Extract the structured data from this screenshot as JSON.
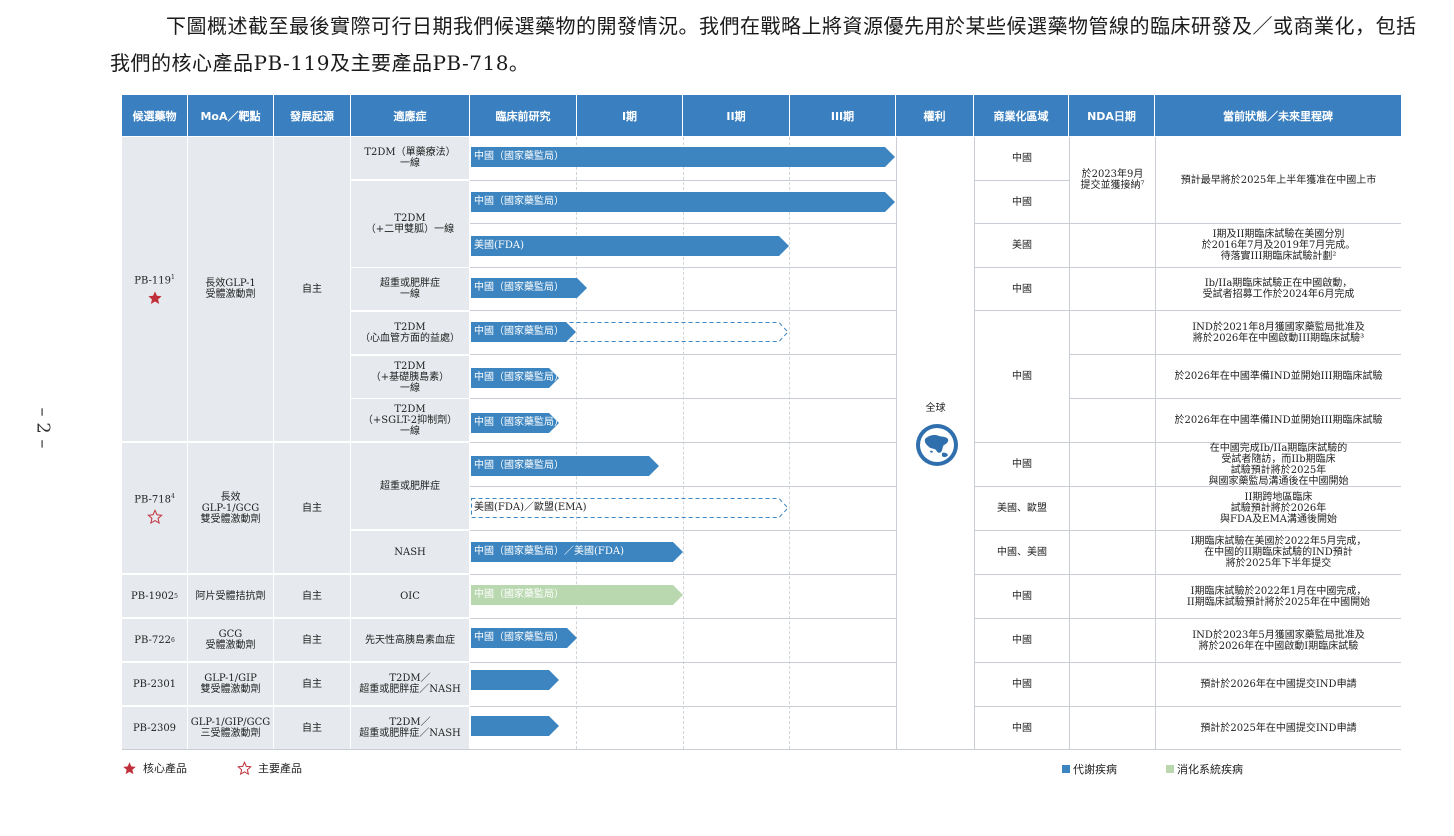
{
  "intro": "下圖概述截至最後實際可行日期我們候選藥物的開發情況。我們在戰略上將資源優先用於某些候選藥物管線的臨床研發及／或商業化，包括我們的核心產品PB-119及主要產品PB-718。",
  "page_number": "– 2 –",
  "headers": [
    "候選藥物",
    "MoA／靶點",
    "發展起源",
    "適應症",
    "臨床前研究",
    "I期",
    "II期",
    "III期",
    "權利",
    "商業化區域",
    "NDA日期",
    "當前狀態／未來里程碑"
  ],
  "drugs": [
    {
      "name": "PB-119",
      "sup": "1",
      "moa": "長效GLP-1\n受體激動劑",
      "origin": "自主"
    },
    {
      "name": "PB-718",
      "sup": "4",
      "moa": "長效\nGLP-1/GCG\n雙受體激動劑",
      "origin": "自主"
    },
    {
      "name": "PB-1902",
      "sup": "5",
      "moa": "阿片受體拮抗劑",
      "origin": "自主"
    },
    {
      "name": "PB-722",
      "sup": "6",
      "moa": "GCG\n受體激動劑",
      "origin": "自主"
    },
    {
      "name": "PB-2301",
      "sup": "",
      "moa": "GLP-1/GIP\n雙受體激動劑",
      "origin": "自主"
    },
    {
      "name": "PB-2309",
      "sup": "",
      "moa": "GLP-1/GIP/GCG\n三受體激動劑",
      "origin": "自主"
    }
  ],
  "indications": [
    "T2DM（單藥療法）\n一線",
    "T2DM\n（+二甲雙胍）一線",
    "超重或肥胖症\n一線",
    "T2DM\n（心血管方面的益處）",
    "T2DM\n（+基礎胰島素）\n一線",
    "T2DM\n（+SGLT-2抑制劑）\n一線",
    "超重或肥胖症",
    "NASH",
    "OIC",
    "先天性高胰島素血症",
    "T2DM／\n超重或肥胖症／NASH",
    "T2DM／\n超重或肥胖症／NASH"
  ],
  "bars": [
    {
      "label": "中國（國家藥監局）",
      "progress": "III期",
      "type": "solid"
    },
    {
      "label": "中國（國家藥監局）",
      "progress": "III期",
      "type": "solid"
    },
    {
      "label": "美國(FDA)",
      "progress": "II期",
      "type": "solid"
    },
    {
      "label": "中國（國家藥監局）",
      "progress": "I期",
      "type": "solid"
    },
    {
      "label": "中國（國家藥監局）",
      "progress": "臨床前研究",
      "type": "solid",
      "planned_to": "II期"
    },
    {
      "label": "中國（國家藥監局）",
      "progress": "臨床前研究",
      "type": "solid"
    },
    {
      "label": "中國（國家藥監局）",
      "progress": "臨床前研究",
      "type": "solid"
    },
    {
      "label": "中國（國家藥監局）",
      "progress": "I期",
      "type": "solid"
    },
    {
      "label": "美國(FDA)／歐盟(EMA)",
      "progress": "II期",
      "type": "planned"
    },
    {
      "label": "中國（國家藥監局）／美國(FDA)",
      "progress": "I期",
      "type": "solid"
    },
    {
      "label": "中國（國家藥監局）",
      "progress": "I期",
      "type": "green"
    },
    {
      "label": "中國（國家藥監局）",
      "progress": "臨床前研究",
      "type": "solid"
    },
    {
      "label": "",
      "progress": "臨床前研究",
      "type": "solid"
    },
    {
      "label": "",
      "progress": "臨床前研究",
      "type": "solid"
    }
  ],
  "rights": "全球",
  "regions": [
    "中國",
    "中國",
    "美國",
    "中國",
    "中國",
    "中國",
    "美國、歐盟",
    "中國、美國",
    "中國",
    "中國",
    "中國",
    "中國"
  ],
  "nda": "於2023年9月\n提交並獲接納⁷",
  "status": [
    "預計最早將於2025年上半年獲准在中國上市",
    "I期及II期臨床試驗在美國分別\n於2016年7月及2019年7月完成。\n待落實III期臨床試驗計劃²",
    "Ib/IIa期臨床試驗正在中國啟動，\n受試者招募工作於2024年6月完成",
    "IND於2021年8月獲國家藥監局批准及\n將於2026年在中國啟動III期臨床試驗³",
    "於2026年在中國準備IND並開始III期臨床試驗",
    "於2026年在中國準備IND並開始III期臨床試驗",
    "在中國完成Ib/IIa期臨床試驗的\n受試者隨訪，而IIb期臨床\n試驗預計將於2025年\n與國家藥監局溝通後在中國開始",
    "II期跨地區臨床\n試驗預計將於2026年\n與FDA及EMA溝通後開始",
    "I期臨床試驗在美國於2022年5月完成，\n在中國的II期臨床試驗的IND預計\n將於2025年下半年提交",
    "I期臨床試驗於2022年1月在中國完成，\nII期臨床試驗預計將於2025年在中國開始",
    "IND於2023年5月獲國家藥監局批准及\n將於2026年在中國啟動I期臨床試驗",
    "預計於2026年在中國提交IND申請",
    "預計於2025年在中國提交IND申請"
  ],
  "legend": {
    "core": "核心產品",
    "key": "主要產品",
    "metabolic": "代謝疾病",
    "digestive": "消化系統疾病"
  },
  "colors": {
    "header": "#3a7fbf",
    "bar_blue": "#3d85c0",
    "bar_green": "#b9d8b0",
    "star": "#c0303a",
    "globe": "#2f6fad"
  }
}
